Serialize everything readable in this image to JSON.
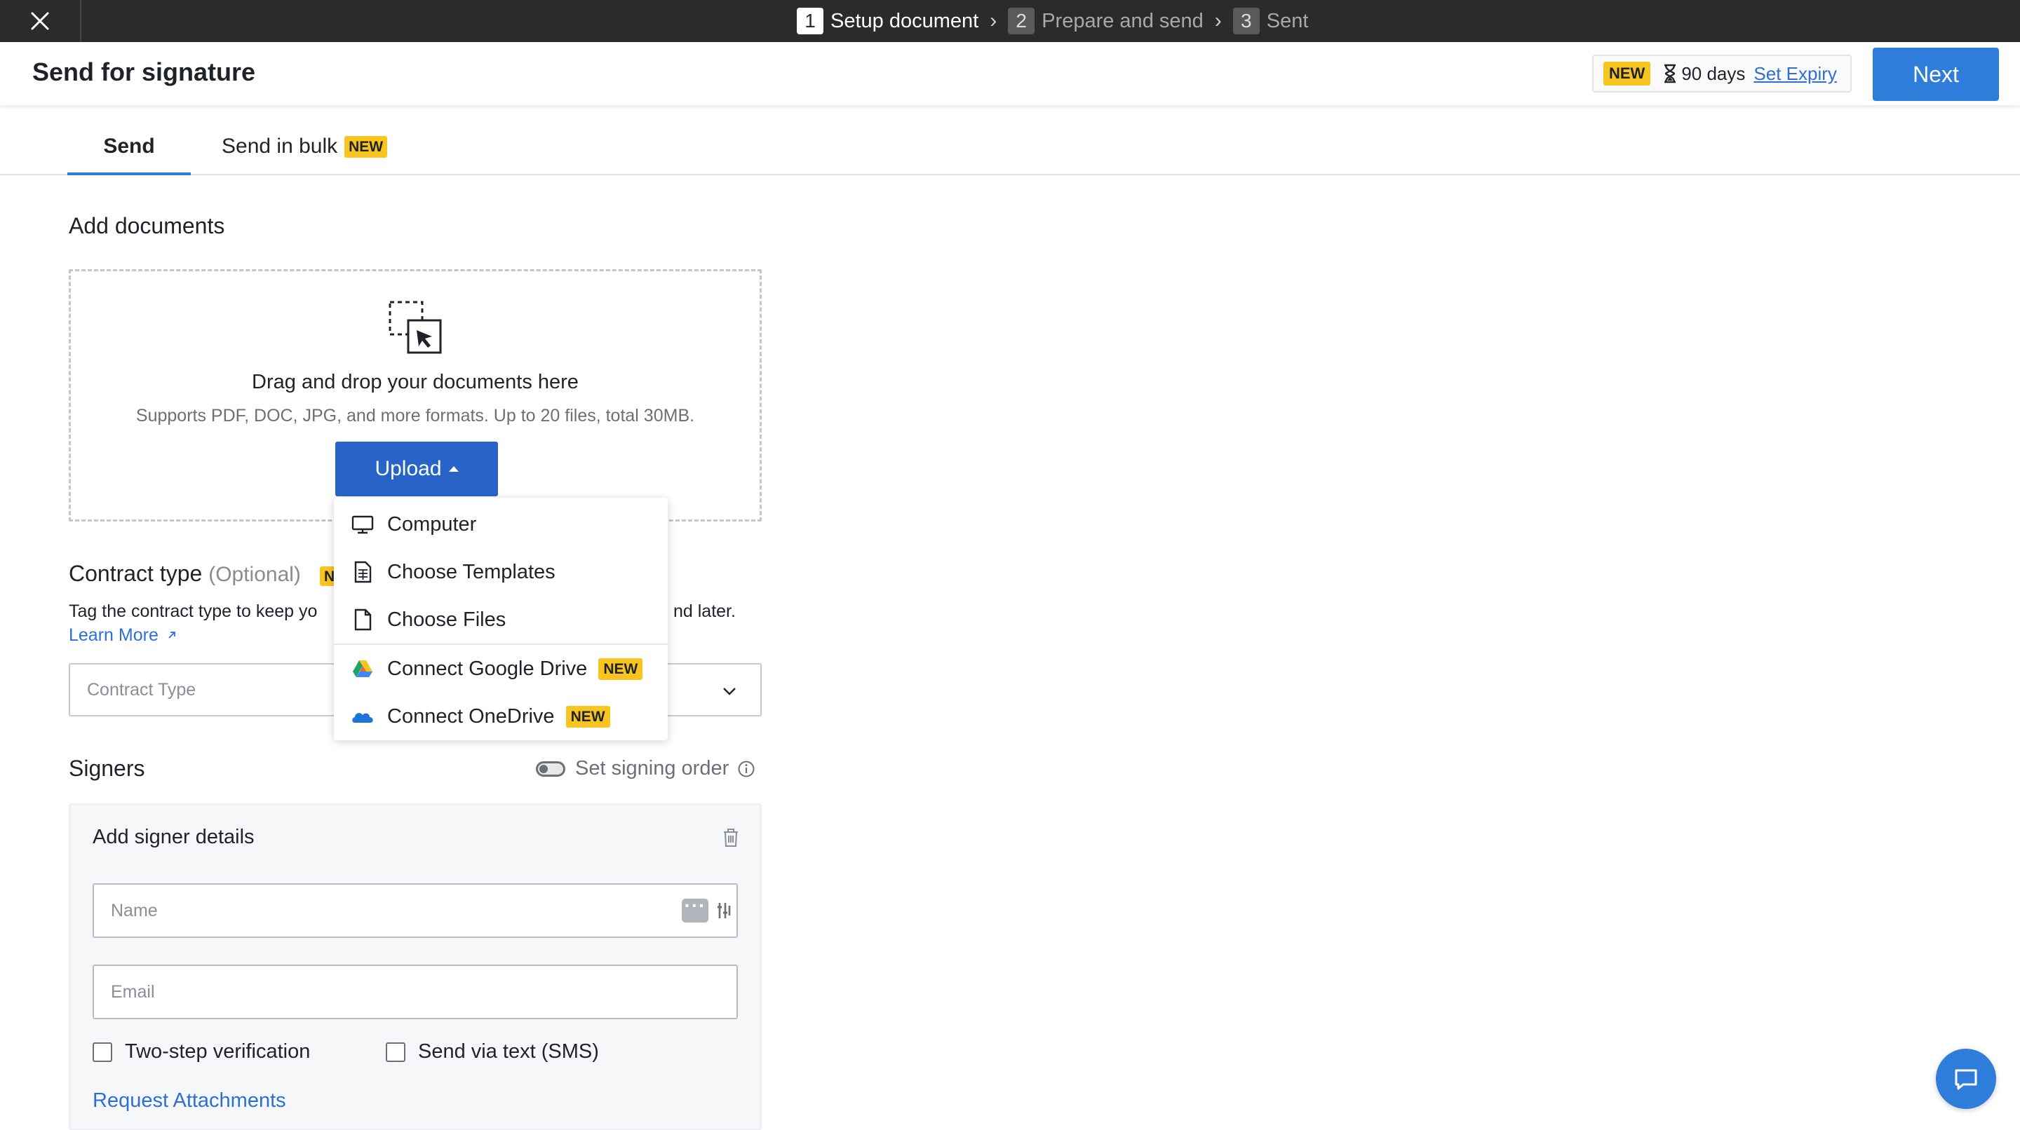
{
  "topbar": {
    "steps": [
      {
        "number": "1",
        "label": "Setup document"
      },
      {
        "number": "2",
        "label": "Prepare and send"
      },
      {
        "number": "3",
        "label": "Sent"
      }
    ],
    "separator": "›",
    "active_step": 1
  },
  "header": {
    "title": "Send for signature",
    "new_badge": "NEW",
    "expiry_days": "90 days",
    "set_expiry": "Set Expiry",
    "next": "Next"
  },
  "tabs": {
    "send": "Send",
    "bulk": "Send in bulk",
    "bulk_badge": "NEW"
  },
  "add_documents": {
    "title": "Add documents",
    "drop_title": "Drag and drop your documents here",
    "drop_sub": "Supports PDF, DOC, JPG, and more formats. Up to 20 files, total 30MB.",
    "upload": "Upload"
  },
  "upload_menu": {
    "items": [
      {
        "label": "Computer",
        "icon": "monitor-icon"
      },
      {
        "label": "Choose Templates",
        "icon": "template-icon"
      },
      {
        "label": "Choose Files",
        "icon": "file-icon"
      },
      {
        "label": "Connect Google Drive",
        "icon": "google-drive-icon",
        "badge": "NEW"
      },
      {
        "label": "Connect OneDrive",
        "icon": "onedrive-icon",
        "badge": "NEW"
      }
    ]
  },
  "contract": {
    "title": "Contract type",
    "optional": "(Optional)",
    "badge_partial": "N",
    "desc_visible": "Tag the contract type to keep yo",
    "desc_tail": "nd later.",
    "learn_more": "Learn More",
    "placeholder": "Contract Type"
  },
  "signers": {
    "title": "Signers",
    "signing_order": "Set signing order",
    "card_title": "Add signer details",
    "name_placeholder": "Name",
    "email_placeholder": "Email",
    "two_step": "Two-step verification",
    "sms": "Send via text (SMS)",
    "request_attachments": "Request Attachments"
  },
  "colors": {
    "primary": "#2f7ddb",
    "upload": "#2864c8",
    "badge": "#f8c420",
    "link": "#2d6fd6",
    "topbar": "#2b2b2b"
  }
}
